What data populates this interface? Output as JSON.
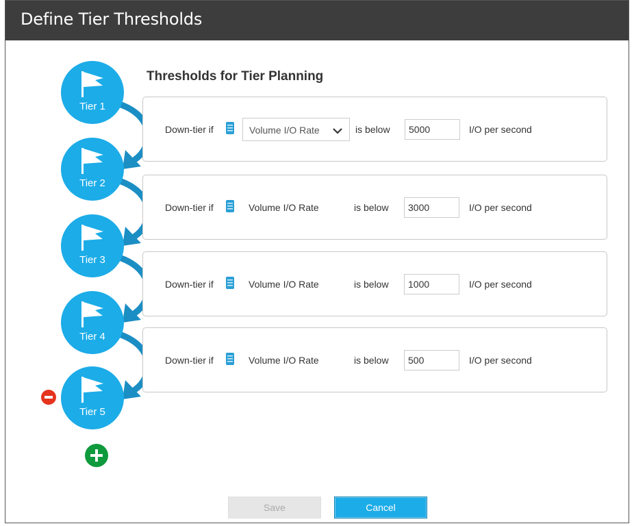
{
  "window": {
    "title": "Define Tier Thresholds"
  },
  "heading": "Thresholds for Tier Planning",
  "tiers": [
    {
      "label": "Tier 1"
    },
    {
      "label": "Tier 2"
    },
    {
      "label": "Tier 3"
    },
    {
      "label": "Tier 4"
    },
    {
      "label": "Tier 5"
    }
  ],
  "thresholds": [
    {
      "condition_label": "Down-tier if",
      "metric": "Volume I/O Rate",
      "metric_is_dropdown": true,
      "comparison": "is below",
      "value": "5000",
      "unit": "I/O per second"
    },
    {
      "condition_label": "Down-tier if",
      "metric": "Volume I/O Rate",
      "metric_is_dropdown": false,
      "comparison": "is below",
      "value": "3000",
      "unit": "I/O per second"
    },
    {
      "condition_label": "Down-tier if",
      "metric": "Volume I/O Rate",
      "metric_is_dropdown": false,
      "comparison": "is below",
      "value": "1000",
      "unit": "I/O per second"
    },
    {
      "condition_label": "Down-tier if",
      "metric": "Volume I/O Rate",
      "metric_is_dropdown": false,
      "comparison": "is below",
      "value": "500",
      "unit": "I/O per second"
    }
  ],
  "icons": {
    "tier": "flag-icon",
    "metric": "database-icon",
    "dropdown": "chevron-down-icon",
    "remove": "remove-tier-icon",
    "add": "add-tier-icon"
  },
  "colors": {
    "titlebar": "#3d3d3d",
    "tier_circle": "#1cace8",
    "connector_arrow": "#1b8ec4",
    "remove": "#e5341d",
    "add": "#0e9a3d",
    "primary_button": "#1cace8",
    "disabled_button": "#e6e6e6"
  },
  "buttons": {
    "save": {
      "label": "Save",
      "enabled": false
    },
    "cancel": {
      "label": "Cancel",
      "enabled": true
    }
  }
}
